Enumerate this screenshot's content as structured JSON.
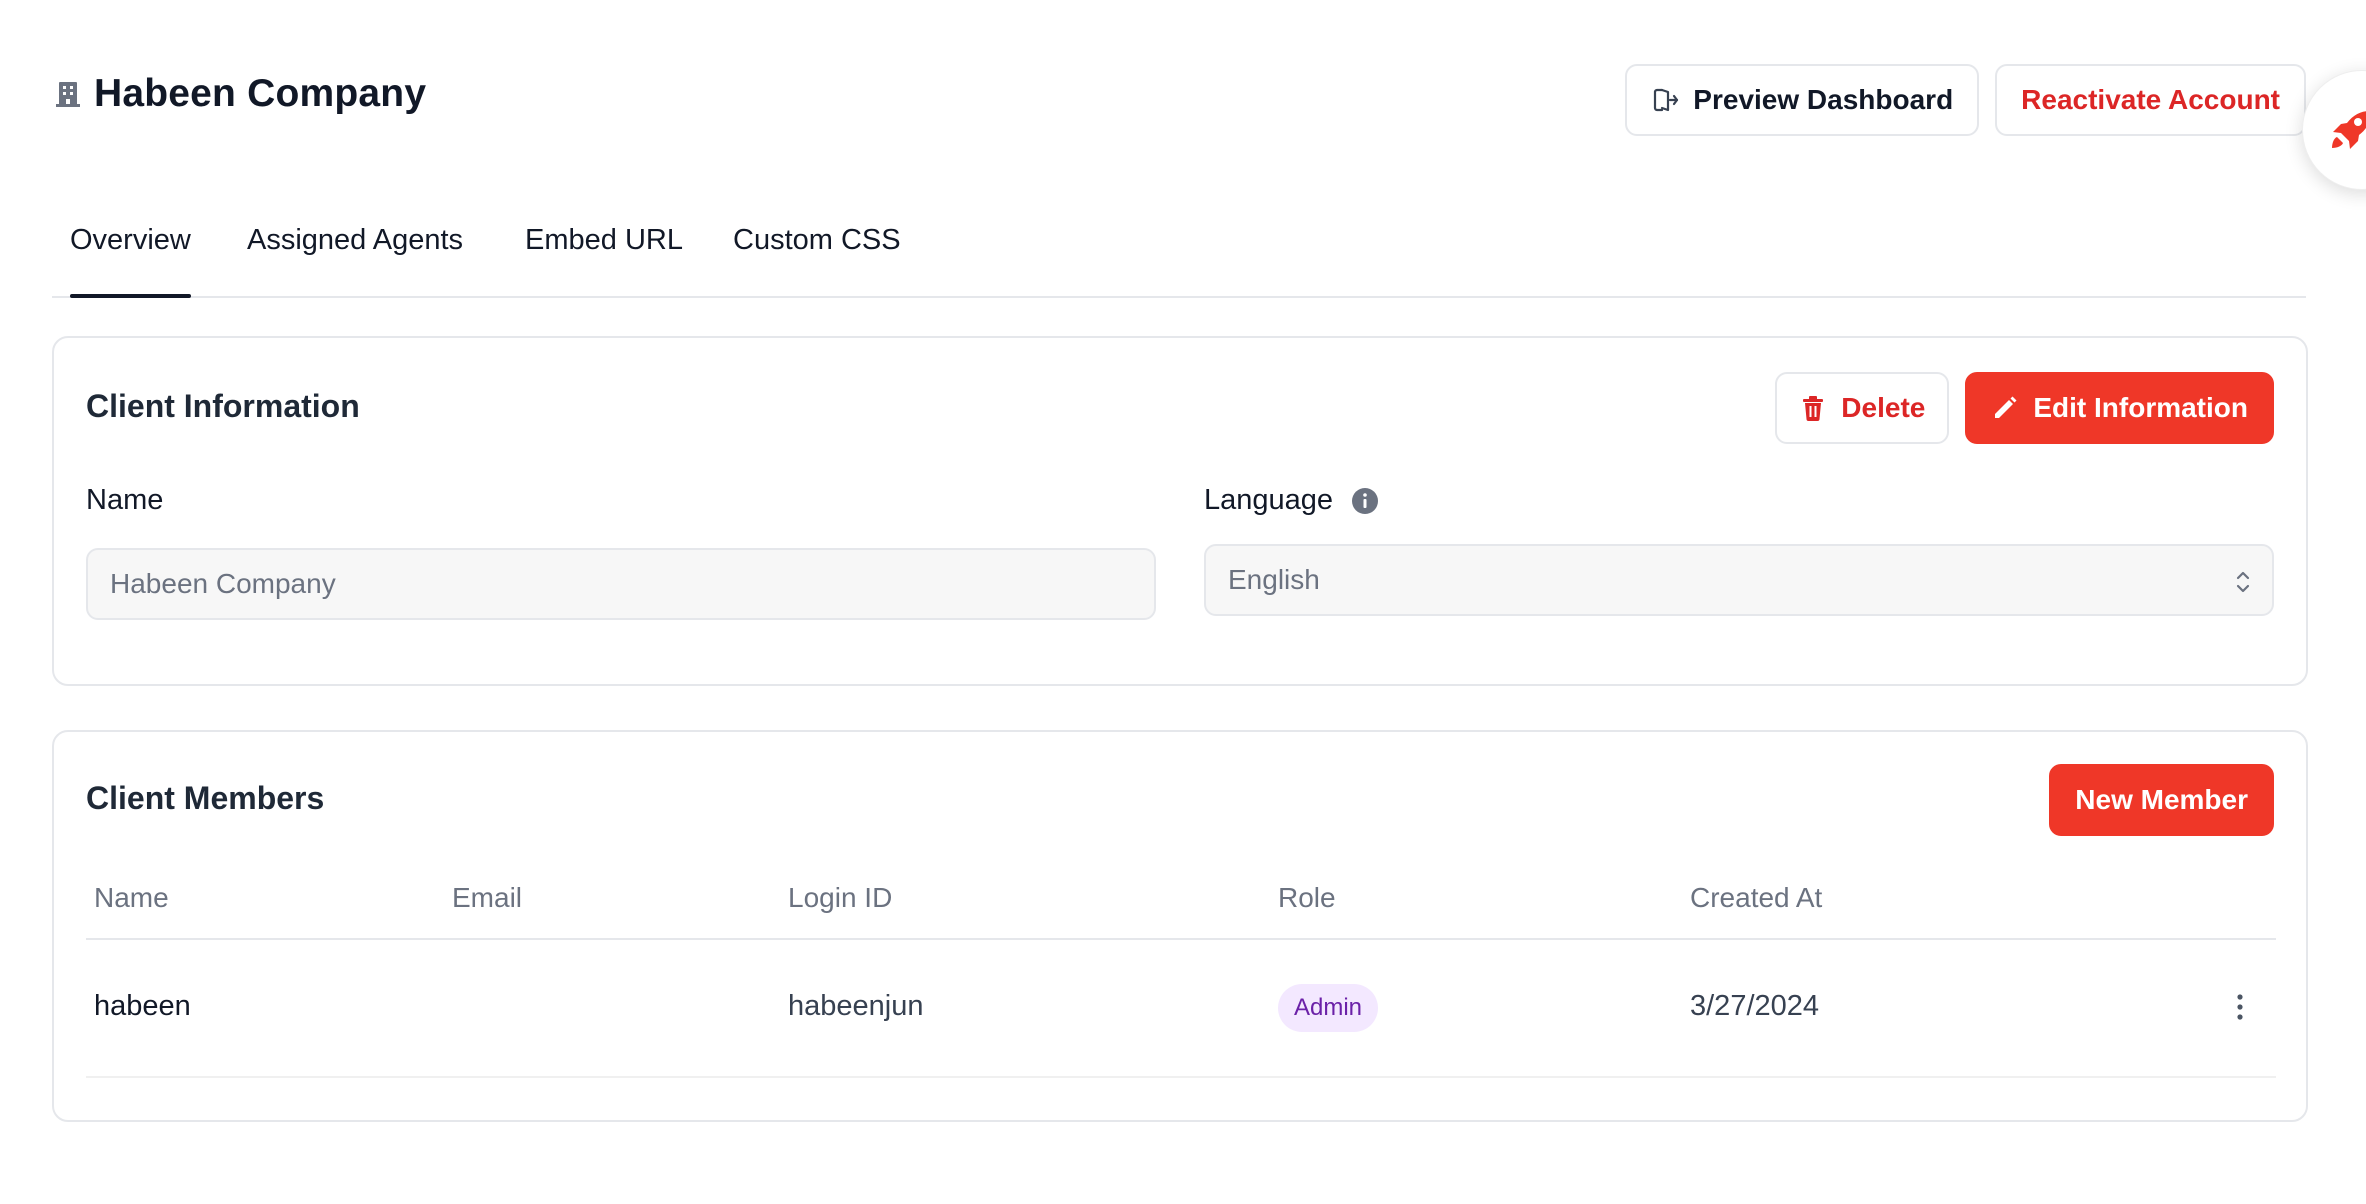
{
  "header": {
    "title": "Habeen Company",
    "title_icon": "building-icon",
    "preview_label": "Preview Dashboard",
    "preview_icon": "exit-icon",
    "reactivate_label": "Reactivate Account"
  },
  "float_widget": {
    "icon": "rocket-icon"
  },
  "tabs": [
    {
      "label": "Overview",
      "active": true
    },
    {
      "label": "Assigned Agents",
      "active": false
    },
    {
      "label": "Embed URL",
      "active": false
    },
    {
      "label": "Custom CSS",
      "active": false
    }
  ],
  "client_info": {
    "title": "Client Information",
    "delete_label": "Delete",
    "edit_label": "Edit Information",
    "name_label": "Name",
    "name_value": "Habeen Company",
    "language_label": "Language",
    "language_value": "English"
  },
  "client_members": {
    "title": "Client Members",
    "new_member_label": "New Member",
    "columns": [
      "Name",
      "Email",
      "Login ID",
      "Role",
      "Created At"
    ],
    "rows": [
      {
        "name": "habeen",
        "email": "",
        "login_id": "habeenjun",
        "role": "Admin",
        "created_at": "3/27/2024"
      }
    ]
  },
  "colors": {
    "accent": "#ef3728",
    "danger_text": "#dc2626",
    "badge_bg": "#f3e8ff",
    "badge_text": "#6b21a8"
  }
}
